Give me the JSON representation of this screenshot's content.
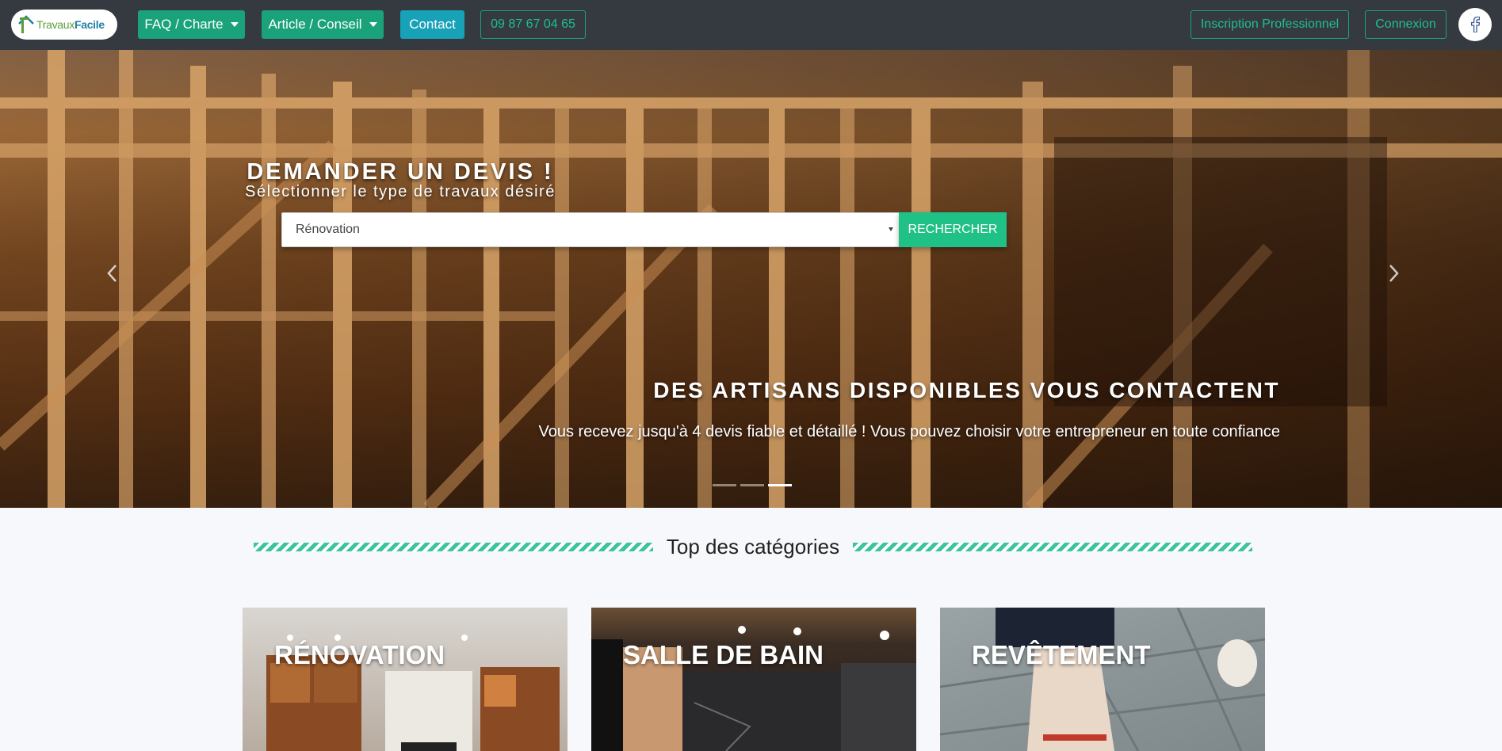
{
  "navbar": {
    "logo": {
      "part1": "Travaux",
      "part2": "Facile"
    },
    "faq_label": "FAQ / Charte",
    "article_label": "Article / Conseil",
    "contact_label": "Contact",
    "phone": "09 87 67 04 65",
    "inscription_label": "Inscription Professionnel",
    "connexion_label": "Connexion",
    "facebook_icon": "facebook-icon"
  },
  "hero": {
    "title": "DEMANDER UN DEVIS !",
    "subtitle": "Sélectionner le type de travaux désiré",
    "select_value": "Rénovation",
    "search_label": "RECHERCHER",
    "caption_title": "DES ARTISANS DISPONIBLES VOUS CONTACTENT",
    "caption_text": "Vous recevez jusqu'à 4 devis fiable et détaillé ! Vous pouvez choisir votre entrepreneur en toute confiance",
    "slides": 3,
    "active_slide": 3
  },
  "categories": {
    "heading": "Top des catégories",
    "items": [
      {
        "label": "RÉNOVATION"
      },
      {
        "label": "SALLE DE BAIN"
      },
      {
        "label": "REVÊTEMENT"
      }
    ]
  },
  "colors": {
    "navbar": "#343a40",
    "green": "#1aa37a",
    "teal": "#17a2b8",
    "search": "#1fc186"
  }
}
